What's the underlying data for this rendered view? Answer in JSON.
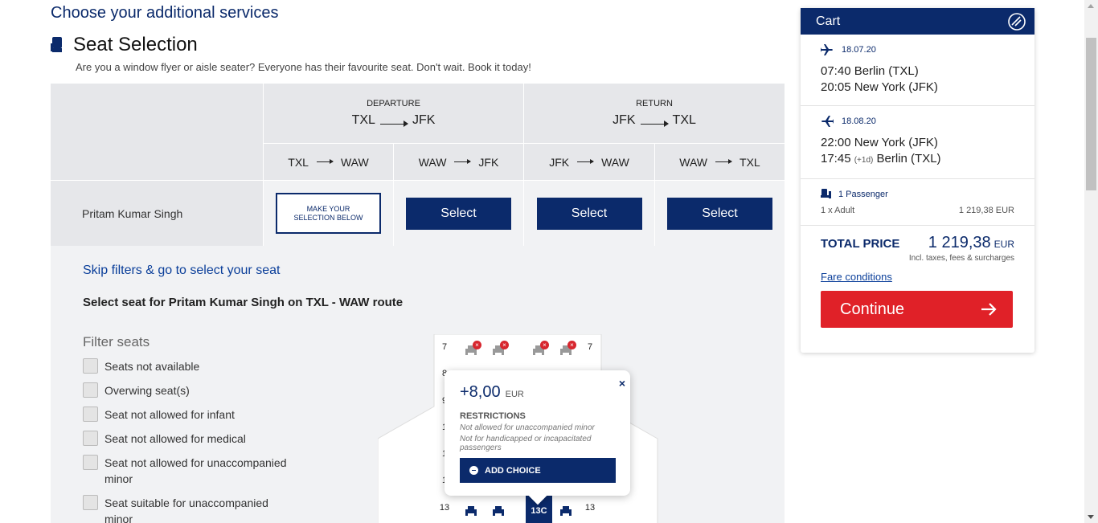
{
  "page": {
    "heading": "Choose your additional services",
    "section_title": "Seat Selection",
    "tagline": "Are you a window flyer or aisle seater? Everyone has their favourite seat. Don't wait. Book it today!"
  },
  "journey": {
    "departure": {
      "label": "DEPARTURE",
      "from": "TXL",
      "to": "JFK"
    },
    "return": {
      "label": "RETURN",
      "from": "JFK",
      "to": "TXL"
    },
    "segments": [
      {
        "from": "TXL",
        "to": "WAW"
      },
      {
        "from": "WAW",
        "to": "JFK"
      },
      {
        "from": "JFK",
        "to": "WAW"
      },
      {
        "from": "WAW",
        "to": "TXL"
      }
    ],
    "passenger": "Pritam Kumar Singh",
    "make_selection_label": "MAKE YOUR SELECTION BELOW",
    "select_label": "Select"
  },
  "seat_panel": {
    "skip_link": "Skip filters & go to select your seat",
    "select_for": "Select seat for Pritam Kumar Singh on TXL - WAW route",
    "filter_title": "Filter seats",
    "filters": [
      "Seats not available",
      "Overwing seat(s)",
      "Seat not allowed for infant",
      "Seat not allowed for medical",
      "Seat not allowed for unaccompanied minor",
      "Seat suitable for unaccompanied minor"
    ]
  },
  "seatmap": {
    "rows_visible": [
      "7",
      "8",
      "9",
      "1",
      "1",
      "1",
      "13"
    ],
    "selected_seat": "13C"
  },
  "popup": {
    "price": "+8,00",
    "currency": "EUR",
    "restrictions_title": "RESTRICTIONS",
    "restriction_1": "Not allowed for unaccompanied minor",
    "restriction_2": "Not for handicapped or incapacitated passengers",
    "add_choice": "ADD CHOICE",
    "close": "×"
  },
  "cart": {
    "title": "Cart",
    "outbound": {
      "date": "18.07.20",
      "dep": "07:40 Berlin (TXL)",
      "arr": "20:05 New York (JFK)"
    },
    "inbound": {
      "date": "18.08.20",
      "dep": "22:00 New York (JFK)",
      "arr_time": "17:45",
      "arr_offset": "(+1d)",
      "arr_city": "Berlin (TXL)"
    },
    "passengers": {
      "label": "1 Passenger",
      "type": "1 x Adult",
      "amount": "1 219,38 EUR"
    },
    "total_label": "TOTAL PRICE",
    "total_value": "1 219,38",
    "total_currency": "EUR",
    "incl": "Incl. taxes, fees & surcharges",
    "fare_conditions": "Fare conditions",
    "continue_label": "Continue"
  },
  "colors": {
    "brand_navy": "#0b2a6b",
    "accent_red": "#e02128",
    "link_blue": "#0b3f9a"
  }
}
